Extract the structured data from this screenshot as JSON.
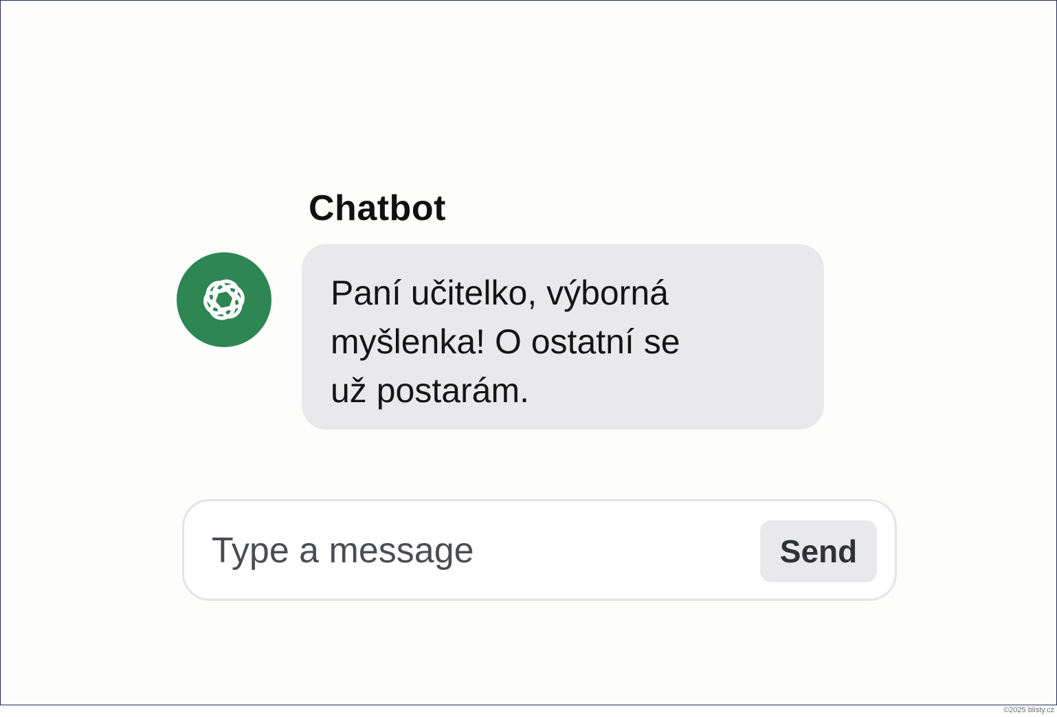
{
  "chat": {
    "sender_name": "Chatbot",
    "avatar_icon": "chatbot-logo-icon",
    "message_lines": [
      "Paní učitelko, výborná",
      "myšlenka! O ostatní se",
      "už postarám."
    ]
  },
  "composer": {
    "placeholder": "Type a message",
    "value": "",
    "send_label": "Send"
  },
  "footer": {
    "copyright": "©2025 blisty.cz"
  },
  "colors": {
    "avatar_background": "#2e8653",
    "bubble_background": "#e9e9eb",
    "send_button_background": "#e9e9eb",
    "frame_border": "#1f2a5c"
  }
}
